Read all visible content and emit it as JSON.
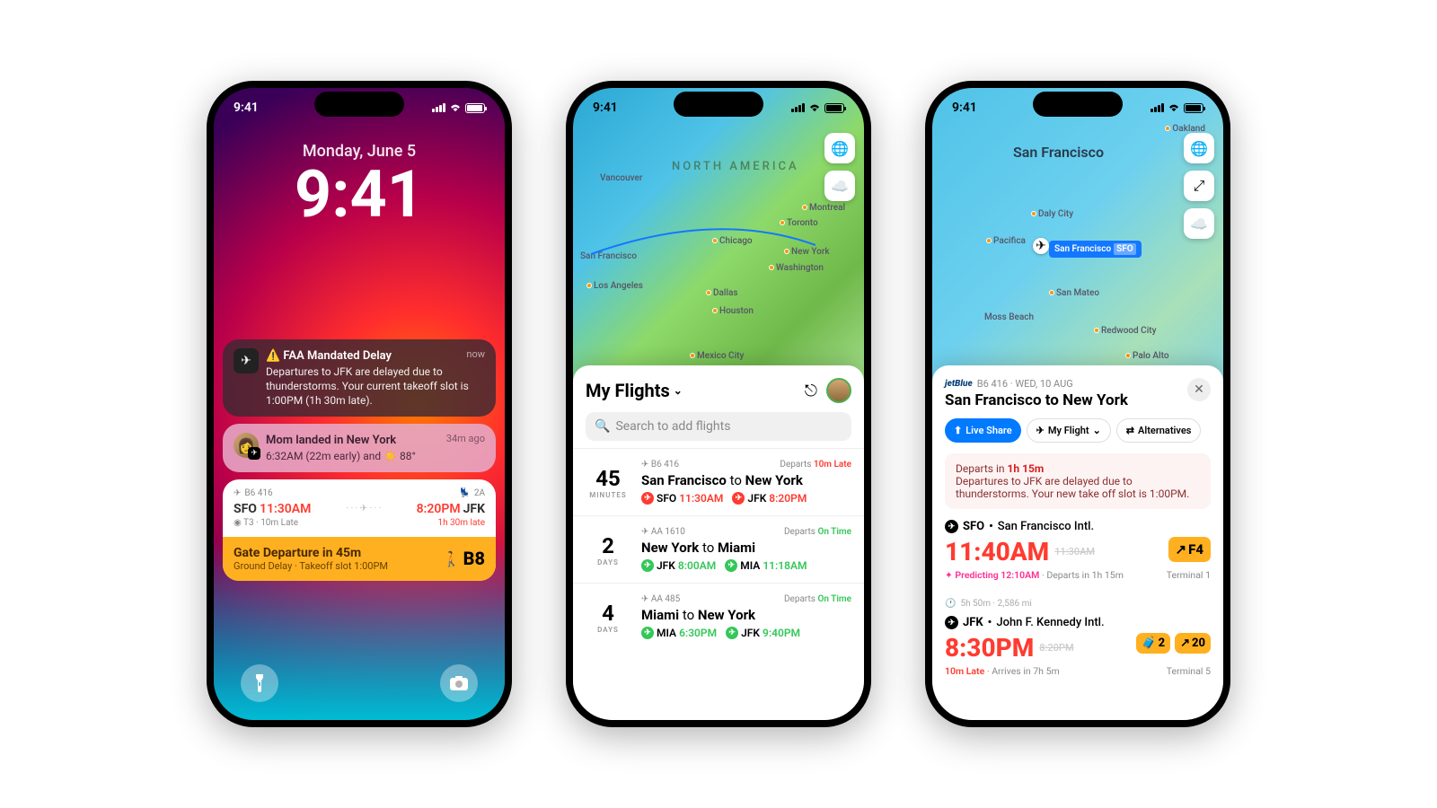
{
  "status": {
    "time": "9:41"
  },
  "phone1": {
    "date": "Monday, June 5",
    "time": "9:41",
    "notif1": {
      "title": "FAA Mandated Delay",
      "text": "Departures to JFK are delayed due to thunderstorms. Your current takeoff slot is 1:00PM (1h 30m late).",
      "when": "now"
    },
    "notif2": {
      "title": "Mom landed in New York",
      "text": "6:32AM (22m early) and ☀️ 88°",
      "when": "34m ago"
    },
    "flight": {
      "carrier": "B6 416",
      "seat": "2A",
      "from": "SFO",
      "fromTime": "11:30AM",
      "to": "JFK",
      "toTime": "8:20PM",
      "term": "T3",
      "termLate": "10m Late",
      "arrLate": "1h 30m late"
    },
    "gate": {
      "title": "Gate Departure in 45m",
      "sub": "Ground Delay · Takeoff slot 1:00PM",
      "gate": "B8"
    }
  },
  "phone2": {
    "title": "My Flights",
    "search": "Search to add flights",
    "map": {
      "continent": "NORTH AMERICA",
      "cities": [
        "Vancouver",
        "Chicago",
        "Toronto",
        "Montreal",
        "New York",
        "Washington",
        "Dallas",
        "Houston",
        "San Francisco",
        "Los Angeles",
        "Mexico City"
      ]
    },
    "flights": [
      {
        "inN": "45",
        "inU": "MINUTES",
        "airline": "B6 416",
        "status": "10m Late",
        "statusType": "late",
        "route": [
          "San Francisco",
          "New York"
        ],
        "d": {
          "ap": "SFO",
          "t": "11:30AM",
          "c": "red"
        },
        "a": {
          "ap": "JFK",
          "t": "8:20PM",
          "c": "red"
        }
      },
      {
        "inN": "2",
        "inU": "DAYS",
        "airline": "AA 1610",
        "status": "On Time",
        "statusType": "ontime",
        "route": [
          "New York",
          "Miami"
        ],
        "d": {
          "ap": "JFK",
          "t": "8:00AM",
          "c": "green"
        },
        "a": {
          "ap": "MIA",
          "t": "11:18AM",
          "c": "green"
        }
      },
      {
        "inN": "4",
        "inU": "DAYS",
        "airline": "AA 485",
        "status": "On Time",
        "statusType": "ontime",
        "route": [
          "Miami",
          "New York"
        ],
        "d": {
          "ap": "MIA",
          "t": "6:30PM",
          "c": "green"
        },
        "a": {
          "ap": "JFK",
          "t": "9:40PM",
          "c": "green"
        }
      }
    ]
  },
  "phone3": {
    "map": {
      "main": "San Francisco",
      "pin": "San Francisco",
      "pinCode": "SFO",
      "cities": [
        "Oakland",
        "Daly City",
        "Pacifica",
        "San Mateo",
        "Moss Beach",
        "Redwood City",
        "Palo Alto"
      ]
    },
    "head": {
      "brand": "jetBlue",
      "meta": "B6 416 · WED, 10 AUG",
      "title": "San Francisco to New York"
    },
    "pills": {
      "live": "Live Share",
      "my": "My Flight",
      "alt": "Alternatives"
    },
    "alert": {
      "lead": "Departs in",
      "leadHi": "1h 15m",
      "body": "Departures to JFK are delayed due to thunderstorms. Your new take off slot is 1:00PM."
    },
    "dep": {
      "ap": "SFO",
      "name": "San Francisco Intl.",
      "t": "11:40AM",
      "old": "11:30AM",
      "gate": "F4",
      "pred": "Predicting 12:10AM",
      "sub": "Departs in 1h 15m",
      "term": "Terminal 1"
    },
    "mid": "5h 50m · 2,586 mi",
    "arr": {
      "ap": "JFK",
      "name": "John F. Kennedy Intl.",
      "t": "8:30PM",
      "old": "8:20PM",
      "bag": "2",
      "gate": "20",
      "late": "10m Late",
      "sub": "Arrives in 7h 5m",
      "term": "Terminal 5"
    }
  }
}
